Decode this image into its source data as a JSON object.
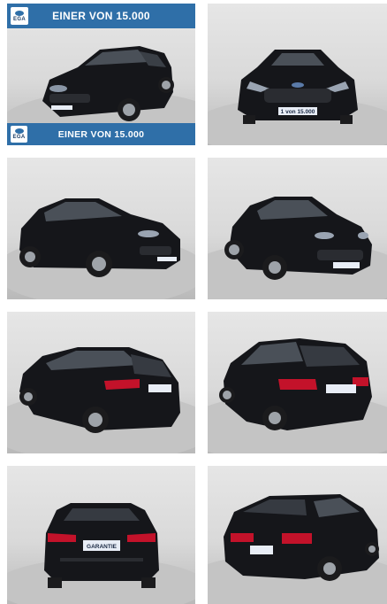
{
  "gallery": {
    "banner_text": "EINER VON 15.000",
    "logo_text": "EGA",
    "plate_front": "1 von 15.000",
    "plate_rear": "GARANTIE",
    "tiles": [
      {
        "view": "front-three-quarter-left",
        "badge": true
      },
      {
        "view": "front"
      },
      {
        "view": "side-front-left"
      },
      {
        "view": "front-three-quarter-right"
      },
      {
        "view": "rear-three-quarter-left"
      },
      {
        "view": "rear-three-quarter-left-close"
      },
      {
        "view": "rear"
      },
      {
        "view": "rear-three-quarter-right"
      }
    ]
  },
  "colors": {
    "banner": "#2f6fa8",
    "car_body": "#15161a",
    "background": "#dcdcdc",
    "floor": "#bdbdbd",
    "tail_light": "#c3122a"
  }
}
